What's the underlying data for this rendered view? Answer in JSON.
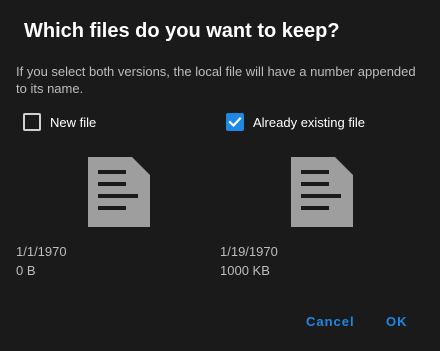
{
  "dialog": {
    "title": "Which files do you want to keep?",
    "message": "If you select both versions, the local file will have a number appended to its name.",
    "accent_color": "#1e88e5"
  },
  "options": {
    "new_file": {
      "label": "New file",
      "checked": false,
      "icon": "document-icon",
      "date": "1/1/1970",
      "size": "0 B"
    },
    "existing_file": {
      "label": "Already existing file",
      "checked": true,
      "icon": "document-icon",
      "date": "1/19/1970",
      "size": "1000 KB"
    }
  },
  "buttons": {
    "cancel_label": "Cancel",
    "ok_label": "OK"
  }
}
